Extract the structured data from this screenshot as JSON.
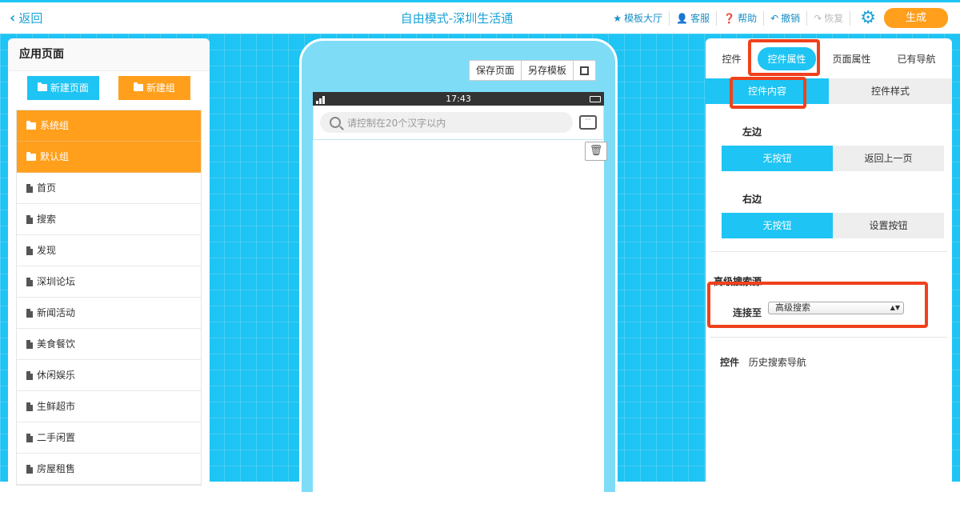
{
  "topbar": {
    "back_label": "返回",
    "title": "自由模式-深圳生活通",
    "toolbar": [
      {
        "label": "模板大厅",
        "icon": "star-icon",
        "disabled": false
      },
      {
        "label": "客服",
        "icon": "user-icon",
        "disabled": false
      },
      {
        "label": "帮助",
        "icon": "help-icon",
        "disabled": false
      },
      {
        "label": "撤销",
        "icon": "undo-icon",
        "disabled": false
      },
      {
        "label": "恢复",
        "icon": "redo-icon",
        "disabled": true
      }
    ],
    "generate_label": "生成"
  },
  "left_panel": {
    "title": "应用页面",
    "new_page_label": "新建页面",
    "new_group_label": "新建组",
    "groups": [
      "系统组",
      "默认组"
    ],
    "pages": [
      "首页",
      "搜索",
      "发现",
      "深圳论坛",
      "新闻活动",
      "美食餐饮",
      "休闲娱乐",
      "生鲜超市",
      "二手闲置",
      "房屋租售"
    ]
  },
  "phone": {
    "tools": [
      "保存页面",
      "另存模板"
    ],
    "time": "17:43",
    "search_placeholder": "请控制在20个汉字以内"
  },
  "right_panel": {
    "tabs": [
      "控件",
      "控件属性",
      "页面属性",
      "已有导航"
    ],
    "active_tab": "控件属性",
    "sub_tabs": [
      "控件内容",
      "控件样式"
    ],
    "left_label": "左边",
    "left_options": [
      "无按钮",
      "返回上一页"
    ],
    "right_label": "右边",
    "right_options": [
      "无按钮",
      "设置按钮"
    ],
    "advanced_title": "高级搜索源",
    "connect_label": "连接至",
    "connect_value": "高级搜索",
    "control_label": "控件",
    "control_value": "历史搜索导航"
  },
  "colors": {
    "accent": "#1ec4f3",
    "orange": "#ff9f1c",
    "highlight": "#f0411c"
  }
}
